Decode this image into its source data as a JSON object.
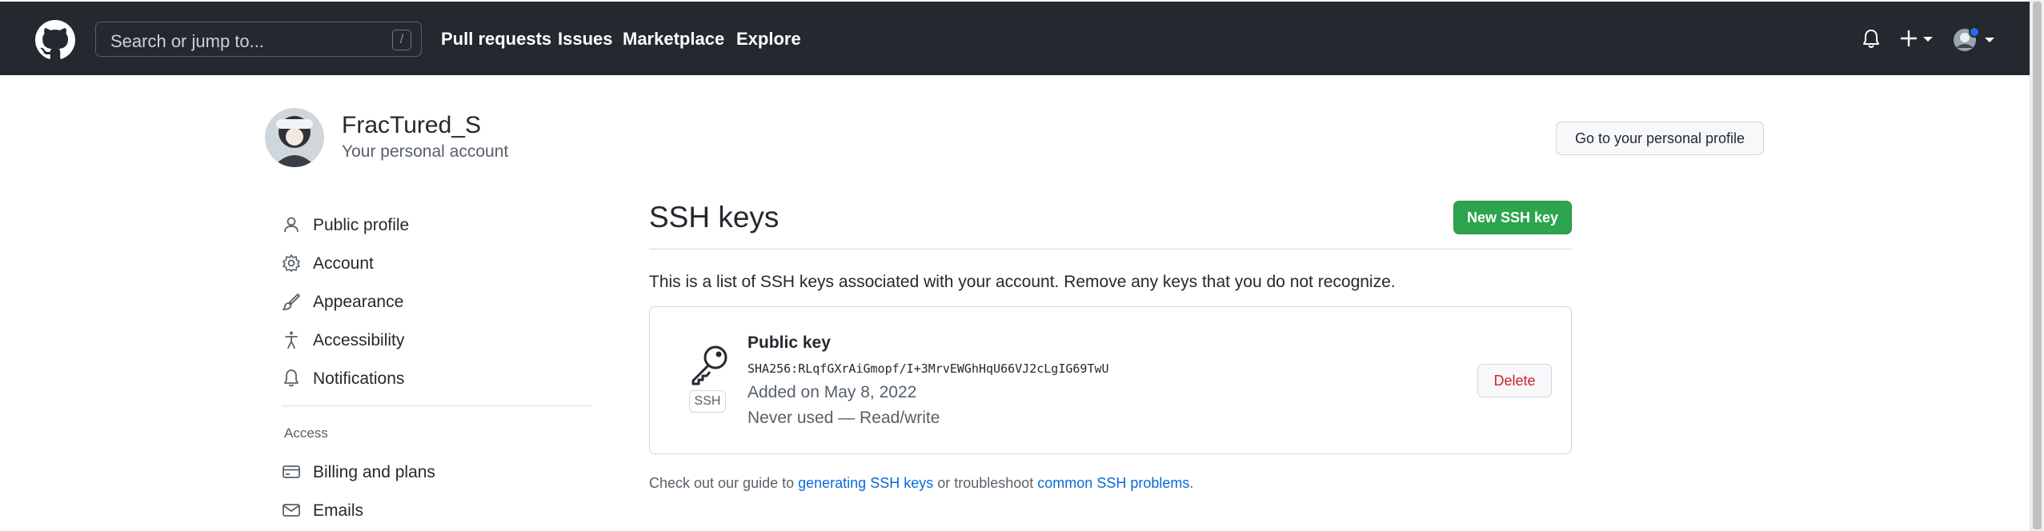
{
  "colors": {
    "header_bg": "#24292f",
    "primary_green": "#2da44e",
    "danger_red": "#cf222e",
    "link_blue": "#0969da",
    "muted_text": "#57606a"
  },
  "header": {
    "search_placeholder": "Search or jump to...",
    "search_shortcut": "/",
    "nav": [
      "Pull requests",
      "Issues",
      "Marketplace",
      "Explore"
    ],
    "icons": [
      "github-logo-icon",
      "bell-icon",
      "plus-icon",
      "avatar-icon"
    ]
  },
  "account": {
    "username": "FracTured_S",
    "subtitle": "Your personal account",
    "profile_button": "Go to your personal profile"
  },
  "sidebar": {
    "items": [
      {
        "label": "Public profile",
        "icon": "person-icon"
      },
      {
        "label": "Account",
        "icon": "gear-icon"
      },
      {
        "label": "Appearance",
        "icon": "paintbrush-icon"
      },
      {
        "label": "Accessibility",
        "icon": "accessibility-icon"
      },
      {
        "label": "Notifications",
        "icon": "bell-icon"
      }
    ],
    "section_title": "Access",
    "access_items": [
      {
        "label": "Billing and plans",
        "icon": "credit-card-icon"
      },
      {
        "label": "Emails",
        "icon": "mail-icon"
      }
    ]
  },
  "main": {
    "title": "SSH keys",
    "new_button": "New SSH key",
    "description": "This is a list of SSH keys associated with your account. Remove any keys that you do not recognize.",
    "key": {
      "badge": "SSH",
      "title": "Public key",
      "fingerprint": "SHA256:RLqfGXrAiGmopf/I+3MrvEWGhHqU66VJ2cLgIG69TwU",
      "added": "Added on May 8, 2022",
      "usage": "Never used — Read/write",
      "delete_button": "Delete"
    },
    "guide": {
      "prefix": "Check out our guide to ",
      "link1": "generating SSH keys",
      "middle": " or troubleshoot ",
      "link2": "common SSH problems",
      "suffix": "."
    }
  }
}
